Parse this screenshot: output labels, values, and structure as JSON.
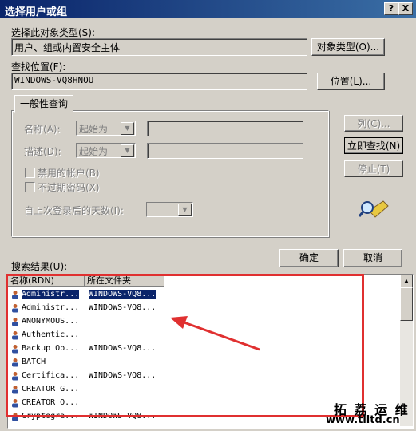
{
  "window": {
    "title": "选择用户或组",
    "help_button": "?",
    "close_button": "X"
  },
  "object_type": {
    "label": "选择此对象类型(S):",
    "value": "用户、组或内置安全主体",
    "button": "对象类型(O)..."
  },
  "location": {
    "label": "查找位置(F):",
    "value": "WINDOWS-VQ8HNOU",
    "button": "位置(L)..."
  },
  "tabs": [
    {
      "label": "一般性查询"
    }
  ],
  "query": {
    "name_label": "名称(A):",
    "name_mode": "起始为",
    "desc_label": "描述(D):",
    "desc_mode": "起始为",
    "disabled_accounts": "禁用的帐户(B)",
    "no_expire_pwd": "不过期密码(X)",
    "days_label": "自上次登录后的天数(I):"
  },
  "side_buttons": {
    "columns": "列(C)...",
    "find_now": "立即查找(N)",
    "stop": "停止(T)"
  },
  "dialog_buttons": {
    "ok": "确定",
    "cancel": "取消"
  },
  "results": {
    "label": "搜索结果(U):",
    "columns": [
      "名称(RDN)",
      "所在文件夹"
    ],
    "rows": [
      {
        "name": "Administr...",
        "folder": "WINDOWS-VQ8...",
        "selected": true
      },
      {
        "name": "Administr...",
        "folder": "WINDOWS-VQ8..."
      },
      {
        "name": "ANONYMOUS...",
        "folder": ""
      },
      {
        "name": "Authentic...",
        "folder": ""
      },
      {
        "name": "Backup Op...",
        "folder": "WINDOWS-VQ8..."
      },
      {
        "name": "BATCH",
        "folder": ""
      },
      {
        "name": "Certifica...",
        "folder": "WINDOWS-VQ8..."
      },
      {
        "name": "CREATOR G...",
        "folder": ""
      },
      {
        "name": "CREATOR O...",
        "folder": ""
      },
      {
        "name": "Cryptogra...",
        "folder": "WINDOWS-VQ8..."
      }
    ]
  },
  "annotation": {
    "color": "#e03030"
  },
  "watermark": {
    "line1": "拓 荔 运 维",
    "line2": "www.tlltd.cn"
  }
}
